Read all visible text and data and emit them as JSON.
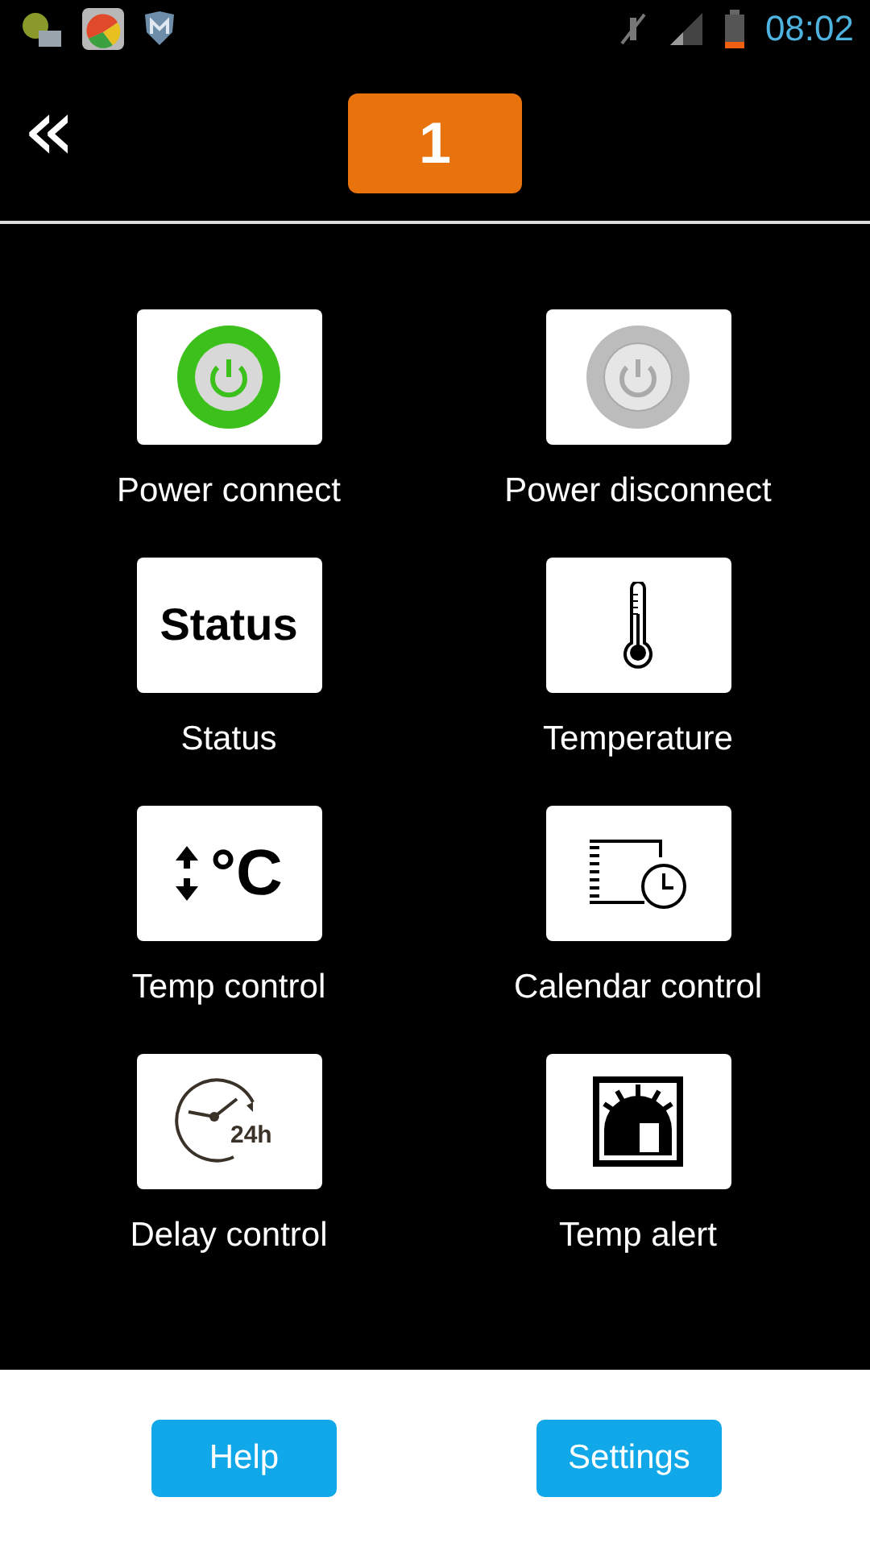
{
  "status_bar": {
    "time": "08:02"
  },
  "header": {
    "back_label": "«",
    "page_badge": "1"
  },
  "tiles": [
    {
      "kind": "power-on",
      "label": "Power connect"
    },
    {
      "kind": "power-off",
      "label": "Power disconnect"
    },
    {
      "kind": "status",
      "label": "Status",
      "icon_text": "Status"
    },
    {
      "kind": "thermometer",
      "label": "Temperature"
    },
    {
      "kind": "temp-control",
      "label": "Temp control",
      "icon_text": "°C"
    },
    {
      "kind": "calendar",
      "label": "Calendar control"
    },
    {
      "kind": "delay",
      "label": "Delay control",
      "icon_text": "24h"
    },
    {
      "kind": "alert",
      "label": "Temp alert"
    }
  ],
  "buttons": [
    "Help",
    "Settings"
  ]
}
